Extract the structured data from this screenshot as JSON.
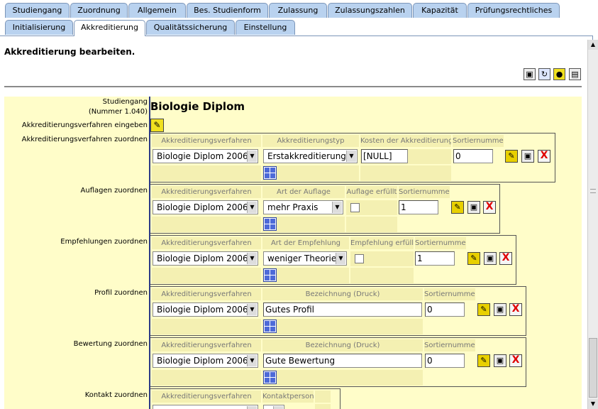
{
  "tabs_row1": [
    "Studiengang",
    "Zuordnung",
    "Allgemein",
    "Bes. Studienform",
    "Zulassung",
    "Zulassungszahlen",
    "Kapazität",
    "Prüfungsrechtliches"
  ],
  "tabs_row2": [
    "Initialisierung",
    "Akkreditierung",
    "Qualitätssicherung",
    "Einstellung"
  ],
  "active_tab": "Akkreditierung",
  "heading": "Akkreditierung bearbeiten.",
  "toolbar_icons": [
    "save-icon",
    "refresh-icon",
    "new-icon",
    "print-icon"
  ],
  "studiengang": {
    "label": "Studiengang",
    "number": "(Nummer 1.040)",
    "name": "Biologie Diplom"
  },
  "verfahren_eingeben_label": "Akkreditierungsverfahren eingeben",
  "sections": {
    "verfahren": {
      "label": "Akkreditierungsverfahren zuordnen",
      "headers": [
        "Akkreditierungsverfahren",
        "Akkreditierungstyp",
        "Kosten der Akkreditierung",
        "Sortiernummer"
      ],
      "row": {
        "verfahren": "Biologie Diplom 2006",
        "typ": "Erstakkreditierung",
        "kosten": "[NULL]",
        "sort": "0"
      }
    },
    "auflagen": {
      "label": "Auflagen zuordnen",
      "headers": [
        "Akkreditierungsverfahren",
        "Art der Auflage",
        "Auflage erfüllt",
        "Sortiernummer"
      ],
      "row": {
        "verfahren": "Biologie Diplom 2006",
        "art": "mehr Praxis",
        "sort": "1"
      }
    },
    "empfehlungen": {
      "label": "Empfehlungen zuordnen",
      "headers": [
        "Akkreditierungsverfahren",
        "Art der Empfehlung",
        "Empfehlung erfüllt",
        "Sortiernummer"
      ],
      "row": {
        "verfahren": "Biologie Diplom 2006",
        "art": "weniger Theorie",
        "sort": "1"
      }
    },
    "profil": {
      "label": "Profil zuordnen",
      "headers": [
        "Akkreditierungsverfahren",
        "Bezeichnung (Druck)",
        "Sortiernummer"
      ],
      "row": {
        "verfahren": "Biologie Diplom 2006",
        "bezeichnung": "Gutes Profil",
        "sort": "0"
      }
    },
    "bewertung": {
      "label": "Bewertung zuordnen",
      "headers": [
        "Akkreditierungsverfahren",
        "Bezeichnung (Druck)",
        "Sortiernummer"
      ],
      "row": {
        "verfahren": "Biologie Diplom 2006",
        "bezeichnung": "Gute Bewertung",
        "sort": "0"
      }
    },
    "kontakt": {
      "label": "Kontakt zuordnen",
      "headers": [
        "Akkreditierungsverfahren",
        "Kontaktperson"
      ]
    }
  },
  "colors": {
    "tab": "#b9d2ef",
    "form_bg": "#fffdc9",
    "header_cell": "#f4f0b2",
    "delete": "#e00000"
  }
}
